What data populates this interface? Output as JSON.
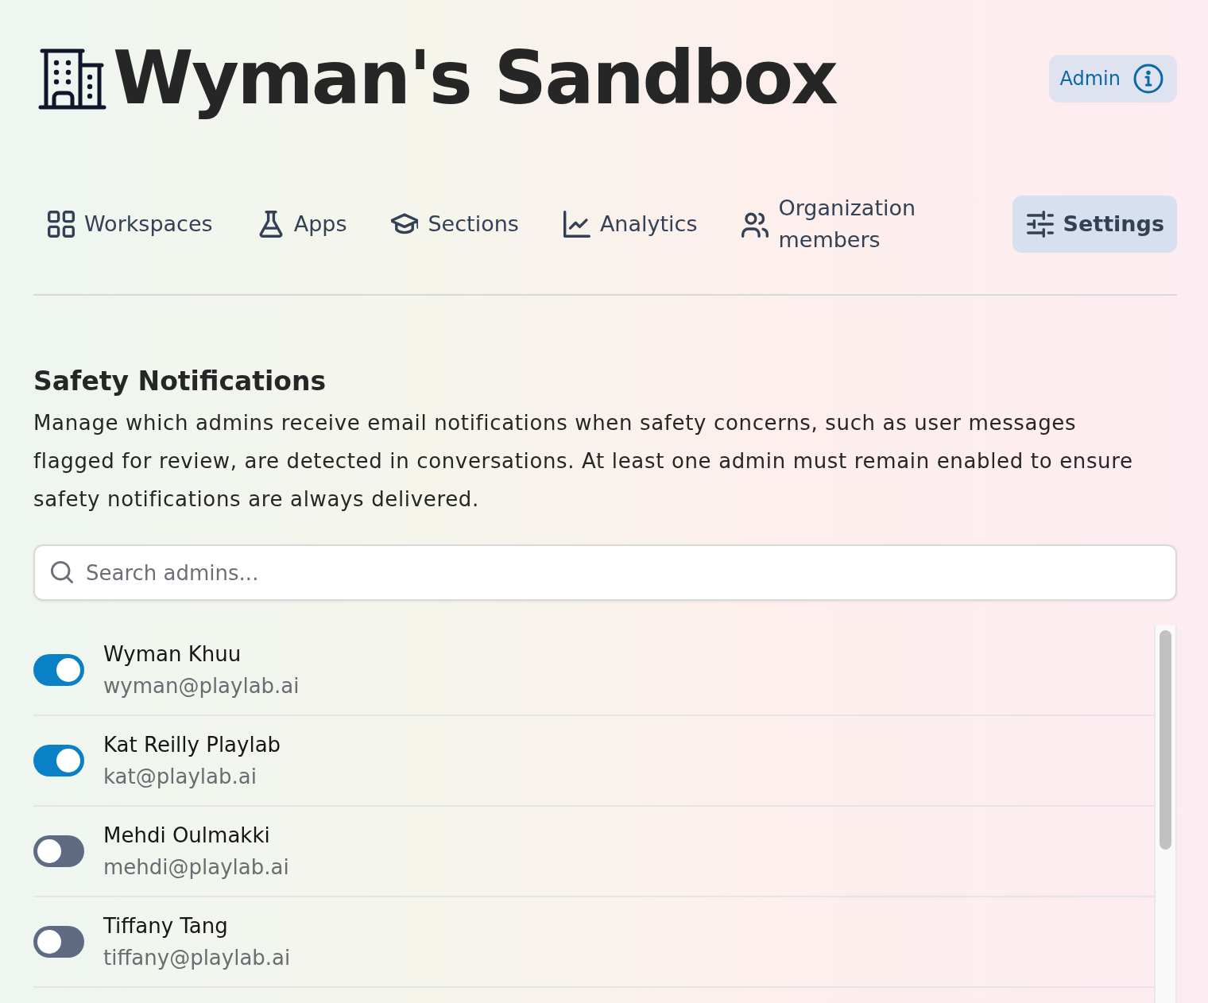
{
  "header": {
    "title": "Wyman's Sandbox",
    "role_badge": "Admin"
  },
  "nav": {
    "tabs": [
      {
        "label": "Workspaces",
        "kind": "grid",
        "selected": false
      },
      {
        "label": "Apps",
        "kind": "flask",
        "selected": false
      },
      {
        "label": "Sections",
        "kind": "cap",
        "selected": false
      },
      {
        "label": "Analytics",
        "kind": "chart",
        "selected": false
      },
      {
        "label": "Organization members",
        "kind": "users",
        "selected": false
      },
      {
        "label": "Settings",
        "kind": "sliders",
        "selected": true
      }
    ]
  },
  "safety_notifications": {
    "heading": "Safety Notifications",
    "description": "Manage which admins receive email notifications when safety concerns, such as user messages flagged for review, are detected in conversations. At least one admin must remain enabled to ensure safety notifications are always delivered.",
    "search": {
      "placeholder": "Search admins..."
    },
    "admins": [
      {
        "name": "Wyman Khuu",
        "email": "wyman@playlab.ai",
        "on": true
      },
      {
        "name": "Kat Reilly Playlab",
        "email": "kat@playlab.ai",
        "on": true
      },
      {
        "name": "Mehdi Oulmakki",
        "email": "mehdi@playlab.ai",
        "on": false
      },
      {
        "name": "Tiffany Tang",
        "email": "tiffany@playlab.ai",
        "on": false
      }
    ]
  }
}
